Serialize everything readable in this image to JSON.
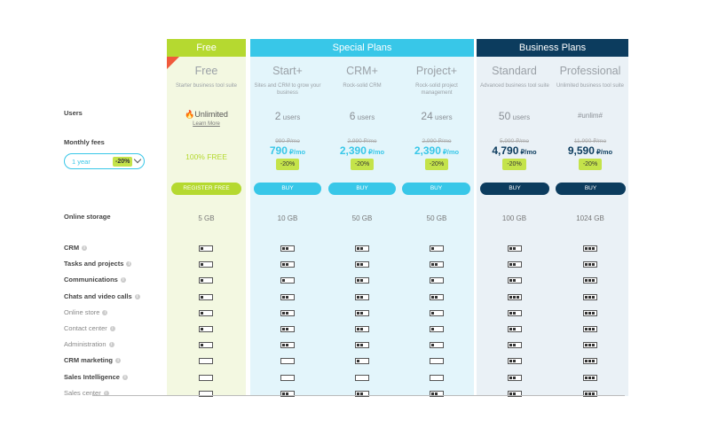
{
  "headers": {
    "free": "Free",
    "special": "Special Plans",
    "business": "Business Plans"
  },
  "plans": [
    {
      "name": "Free",
      "desc": "Starter business tool suite",
      "users_num": "",
      "users_unit": "",
      "old_price": "",
      "price_num": "",
      "price_unit": "",
      "discount": "",
      "button": "REGISTER FREE",
      "storage": "5 GB"
    },
    {
      "name": "Start+",
      "desc": "Sites and CRM to grow your business",
      "users_num": "2",
      "users_unit": " users",
      "old_price": "990 ₽/mo",
      "price_num": "790",
      "price_unit": " ₽/mo",
      "discount": "-20%",
      "button": "BUY",
      "storage": "10 GB"
    },
    {
      "name": "CRM+",
      "desc": "Rock-solid CRM",
      "users_num": "6",
      "users_unit": " users",
      "old_price": "2,990 ₽/mo",
      "price_num": "2,390",
      "price_unit": " ₽/mo",
      "discount": "-20%",
      "button": "BUY",
      "storage": "50 GB"
    },
    {
      "name": "Project+",
      "desc": "Rock-solid project management",
      "users_num": "24",
      "users_unit": " users",
      "old_price": "2,990 ₽/mo",
      "price_num": "2,390",
      "price_unit": " ₽/mo",
      "discount": "-20%",
      "button": "BUY",
      "storage": "50 GB"
    },
    {
      "name": "Standard",
      "desc": "Advanced business tool suite",
      "users_num": "50",
      "users_unit": " users",
      "old_price": "5,990 ₽/mo",
      "price_num": "4,790",
      "price_unit": " ₽/mo",
      "discount": "-20%",
      "button": "BUY",
      "storage": "100 GB"
    },
    {
      "name": "Professional",
      "desc": "Unlimited business tool suite",
      "users_num": "#unlim#",
      "users_unit": "",
      "old_price": "11,990 ₽/mo",
      "price_num": "9,590",
      "price_unit": " ₽/mo",
      "discount": "-20%",
      "button": "BUY",
      "storage": "1024 GB"
    }
  ],
  "free_users": {
    "label": "Unlimited",
    "learn_more": "Learn More"
  },
  "free_price": "100% FREE",
  "row_labels": {
    "users": "Users",
    "monthly_fees": "Monthly fees",
    "storage": "Online storage"
  },
  "period": {
    "value": "1 year",
    "discount": "-20%"
  },
  "features": [
    {
      "label": "CRM",
      "levels": [
        1,
        2,
        2,
        1,
        2,
        3
      ]
    },
    {
      "label": "Tasks and projects",
      "levels": [
        1,
        2,
        2,
        2,
        2,
        3
      ]
    },
    {
      "label": "Communications",
      "levels": [
        1,
        1,
        2,
        1,
        2,
        3
      ]
    },
    {
      "label": "Chats and video calls",
      "levels": [
        1,
        2,
        2,
        2,
        3,
        3
      ]
    },
    {
      "label": "Online store",
      "levels": [
        1,
        2,
        2,
        1,
        2,
        3
      ]
    },
    {
      "label": "Contact center",
      "levels": [
        1,
        2,
        2,
        1,
        2,
        3
      ]
    },
    {
      "label": "Administration",
      "levels": [
        1,
        2,
        2,
        1,
        2,
        3
      ]
    },
    {
      "label": "CRM marketing",
      "levels": [
        0,
        0,
        1,
        0,
        2,
        3
      ]
    },
    {
      "label": "Sales Intelligence",
      "levels": [
        0,
        0,
        0,
        0,
        2,
        3
      ]
    },
    {
      "label": "Sales center",
      "levels": [
        0,
        2,
        2,
        2,
        2,
        3
      ]
    }
  ],
  "colors": {
    "free": "#b5d930",
    "special": "#38c7e8",
    "business": "#0c3c5e",
    "accent_lime": "#c4e34a"
  }
}
